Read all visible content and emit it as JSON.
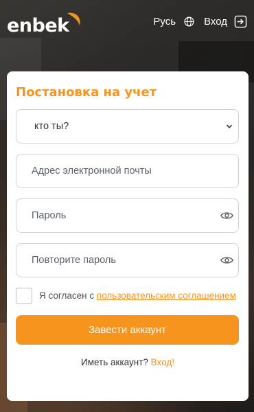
{
  "header": {
    "logo_text": "enbek",
    "language_label": "Русь",
    "login_label": "Вход",
    "icons": [
      "globe-icon",
      "login-icon"
    ]
  },
  "form": {
    "title": "Постановка на учет",
    "role_select_value": "кто ты?",
    "email_placeholder": "Адрес электронной почты",
    "password_placeholder": "Пароль",
    "repeat_password_placeholder": "Повторите пароль",
    "agree_prefix": "Я согласен с ",
    "agree_link": "пользовательским соглашением",
    "submit_label": "Завести аккаунт",
    "have_account_text": "Иметь аккаунт?",
    "have_account_link": "Вход!"
  },
  "colors": {
    "accent": "#f7941d",
    "card_bg": "#ffffff",
    "field_border": "#cfd4dc"
  }
}
